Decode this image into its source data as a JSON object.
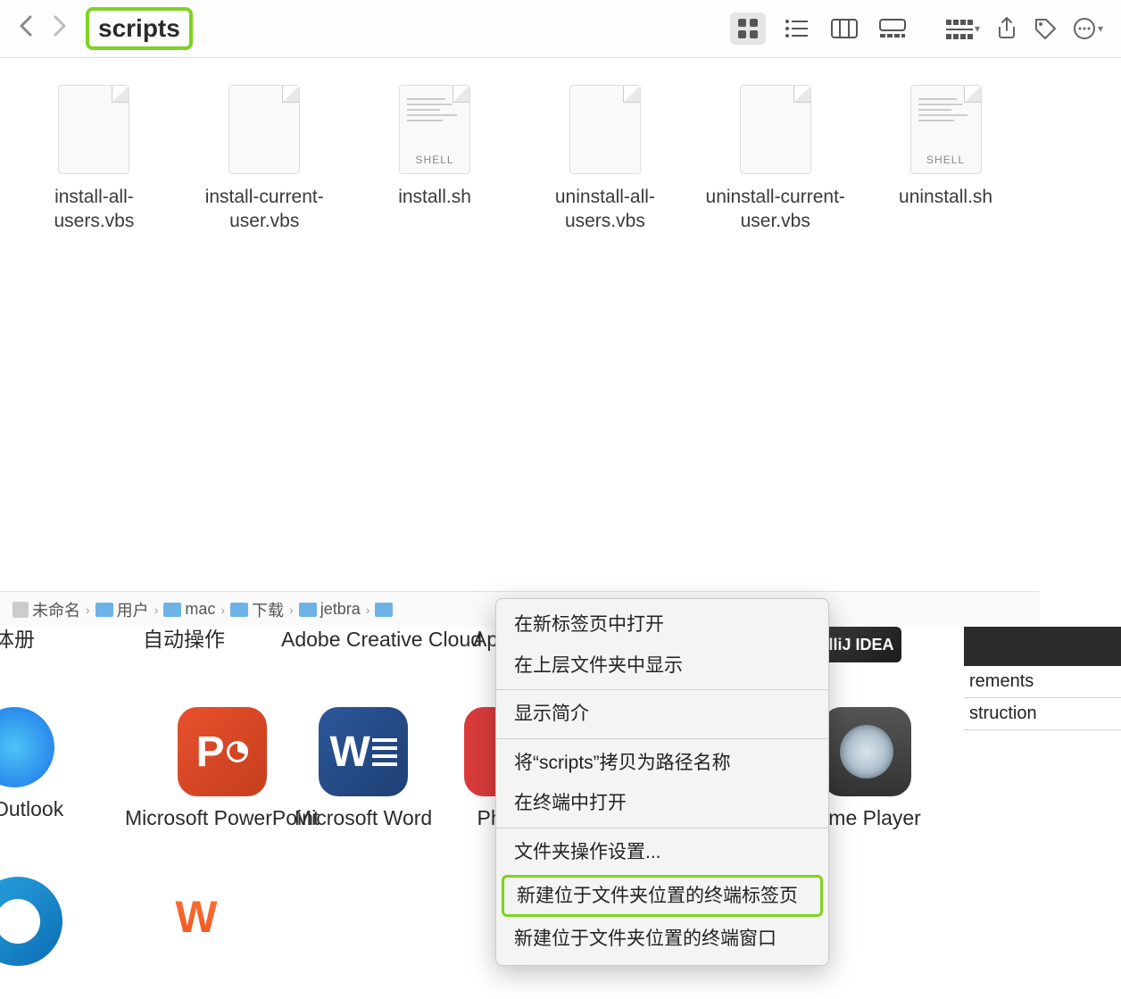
{
  "toolbar": {
    "title": "scripts"
  },
  "files": [
    {
      "name": "install-all-users.vbs",
      "type": "plain"
    },
    {
      "name": "install-current-user.vbs",
      "type": "plain"
    },
    {
      "name": "install.sh",
      "type": "shell",
      "badge": "SHELL"
    },
    {
      "name": "uninstall-all-users.vbs",
      "type": "plain"
    },
    {
      "name": "uninstall-current-user.vbs",
      "type": "plain"
    },
    {
      "name": "uninstall.sh",
      "type": "shell",
      "badge": "SHELL"
    }
  ],
  "path": [
    {
      "name": "未命名",
      "icon": "drive"
    },
    {
      "name": "用户",
      "icon": "folder"
    },
    {
      "name": "mac",
      "icon": "folder"
    },
    {
      "name": "下载",
      "icon": "folder"
    },
    {
      "name": "jetbra",
      "icon": "folder"
    }
  ],
  "apps": {
    "a0": "字体册",
    "a1": "自动操作",
    "a2": "Adobe Creative Cloud",
    "a3": "Ap",
    "outlook": "oft Outlook",
    "ppt": "Microsoft PowerPoint",
    "word": "Microsoft Word",
    "pho": "Pho",
    "idea": "lliJ IDEA",
    "qt": "Time Player"
  },
  "side": {
    "r1": "rements",
    "r2": "struction"
  },
  "context_menu": {
    "open_tab": "在新标签页中打开",
    "show_parent": "在上层文件夹中显示",
    "get_info": "显示简介",
    "copy_path": "将“scripts”拷贝为路径名称",
    "open_terminal": "在终端中打开",
    "folder_actions": "文件夹操作设置...",
    "new_terminal_tab": "新建位于文件夹位置的终端标签页",
    "new_terminal_window": "新建位于文件夹位置的终端窗口"
  },
  "dock": {
    "wps": "W"
  }
}
